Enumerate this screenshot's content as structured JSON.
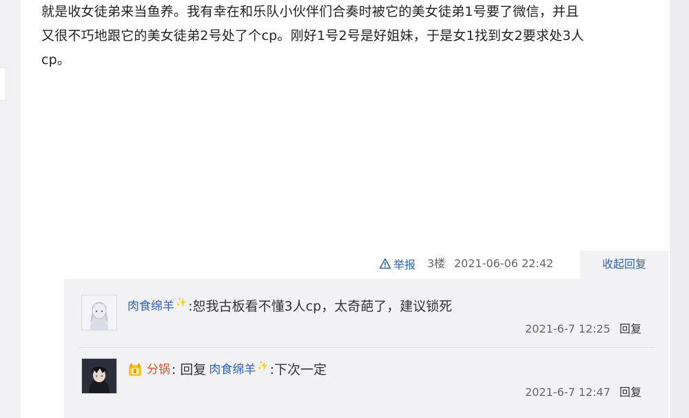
{
  "post": {
    "lines": [
      "就是收女徒弟来当鱼养。我有幸在和乐队小伙伴们合奏时被它的美女徒弟1号要了微信，并且",
      "又很不巧地跟它的美女徒弟2号处了个cp。刚好1号2号是好姐妹，于是女1找到女2要求处3人",
      "cp。"
    ],
    "report_label": "举报",
    "floor": "3楼",
    "time": "2021-06-06 22:42",
    "collapse_label": "收起回复"
  },
  "replies": [
    {
      "user": "肉食绵羊",
      "sparkle": "✨",
      "colon": ":",
      "text": " 恕我古板看不懂3人cp，太奇葩了，建议锁死",
      "time": "2021-6-7 12:25",
      "reply_label": "回复"
    },
    {
      "user": "分锅",
      "colon": ":",
      "reply_word": "回复",
      "target_user": "肉食绵羊",
      "sparkle": "✨",
      "text": ":下次一定",
      "time": "2021-6-7 12:47",
      "reply_label": "回复"
    }
  ],
  "colors": {
    "link": "#2d64b3",
    "vip_name": "#d8552a",
    "reply_bg": "#f2f2f5"
  },
  "icons": [
    "report-icon",
    "sparkle-icon",
    "vip-badge-icon"
  ]
}
